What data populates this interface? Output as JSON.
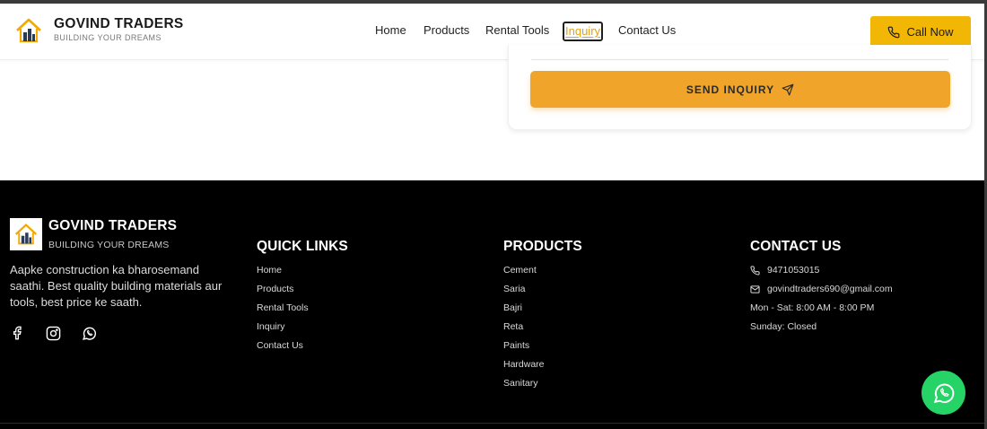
{
  "header": {
    "brand_name": "GOVIND TRADERS",
    "brand_tagline": "BUILDING YOUR DREAMS",
    "nav": [
      {
        "label": "Home",
        "active": false
      },
      {
        "label": "Products",
        "active": false
      },
      {
        "label": "Rental Tools",
        "active": false
      },
      {
        "label": "Inquiry",
        "active": true
      },
      {
        "label": "Contact Us",
        "active": false
      }
    ],
    "call_label": "Call Now"
  },
  "inquiry": {
    "send_label": "SEND INQUIRY"
  },
  "footer": {
    "brand_name": "GOVIND TRADERS",
    "brand_tagline": "BUILDING YOUR DREAMS",
    "description": "Aapke construction ka bharosemand saathi. Best quality building materials aur tools, best price ke saath.",
    "social_icons": [
      "facebook-icon",
      "instagram-icon",
      "whatsapp-icon"
    ],
    "quick_links": {
      "title": "QUICK LINKS",
      "items": [
        "Home",
        "Products",
        "Rental Tools",
        "Inquiry",
        "Contact Us"
      ]
    },
    "products": {
      "title": "PRODUCTS",
      "items": [
        "Cement",
        "Saria",
        "Bajri",
        "Reta",
        "Paints",
        "Hardware",
        "Sanitary"
      ]
    },
    "contact": {
      "title": "CONTACT US",
      "phone": "9471053015",
      "email": "govindtraders690@gmail.com",
      "hours": "Mon - Sat: 8:00 AM - 8:00 PM",
      "sunday": "Sunday: Closed"
    }
  },
  "colors": {
    "accent": "#f2b705",
    "send_button": "#f0a52a",
    "footer_bg": "#000000",
    "whatsapp": "#25d366"
  }
}
